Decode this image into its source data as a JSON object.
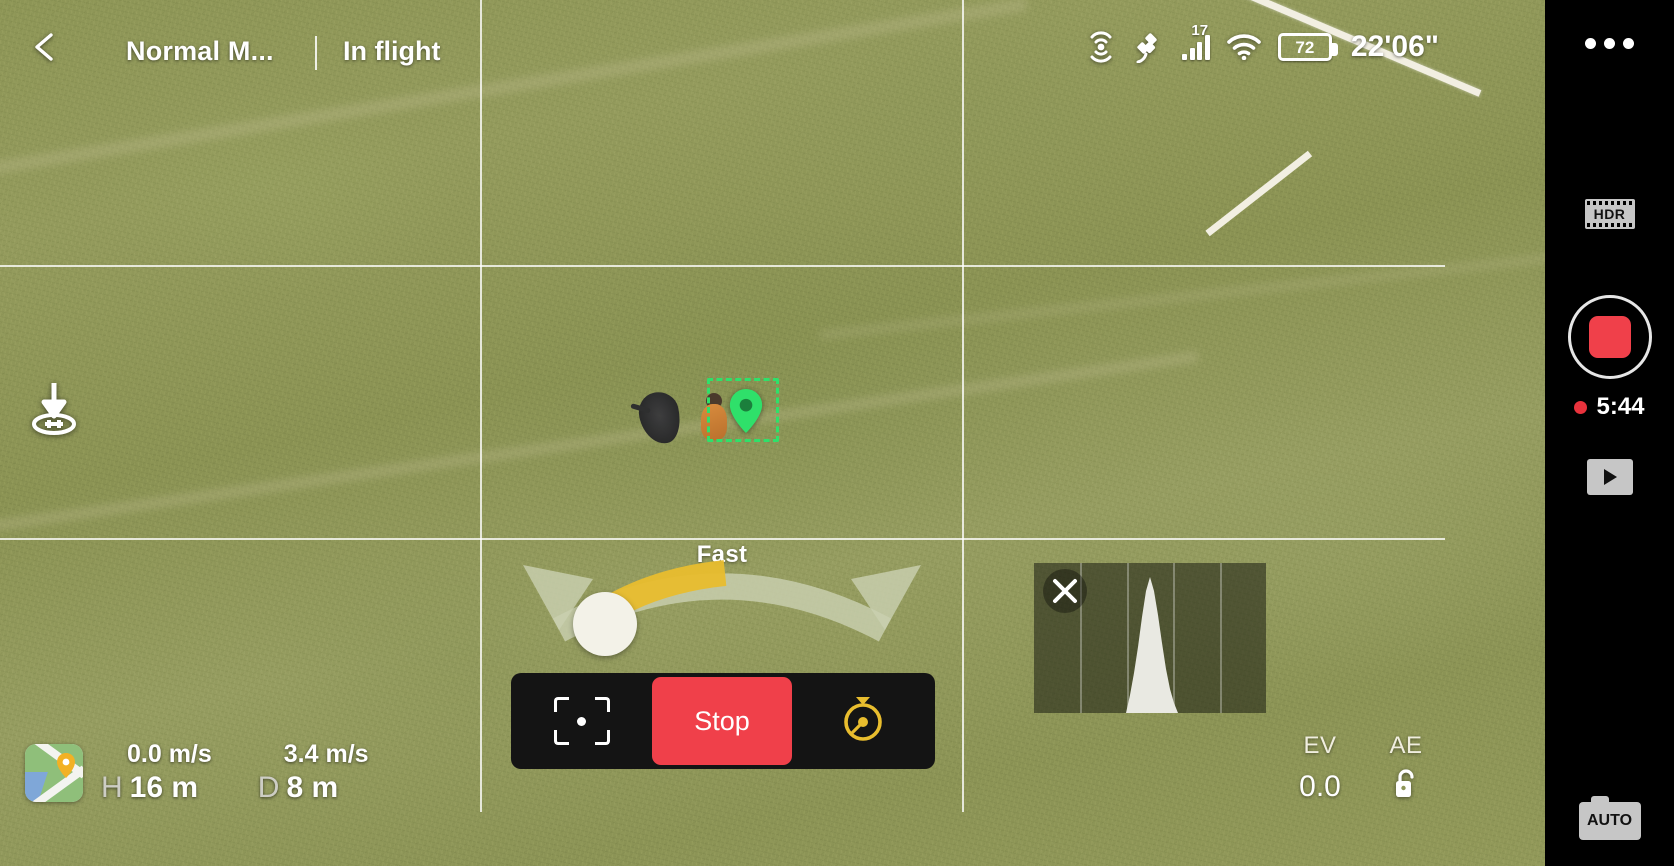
{
  "topbar": {
    "back_icon": "back-chevron-icon",
    "flight_mode": "Normal M...",
    "flight_status": "In flight",
    "status": {
      "rc_signal_icon": "rc-signal-icon",
      "satellite_icon": "satellite-icon",
      "satellite_count": "17",
      "signal_bars_icon": "signal-bars-icon",
      "wifi_icon": "wifi-icon",
      "battery_percent": "72",
      "flight_timer": "22'06\""
    }
  },
  "overlay": {
    "landing_icon": "landing-icon",
    "tracking_pin_icon": "tracking-pin-icon",
    "grid_enabled": true
  },
  "speed_slider": {
    "label": "Fast",
    "knob_icon": "speed-knob",
    "fill_color": "#e8bd2e",
    "track_color": "#c9cfb0"
  },
  "action_bar": {
    "focus_label": "focus-bracket-icon",
    "stop_label": "Stop",
    "stop_color": "#f0404a",
    "gimbal_label": "gimbal-recenter-icon"
  },
  "histogram": {
    "close_icon": "close-icon",
    "visible": true,
    "divisions": 4
  },
  "exposure": {
    "ev_label": "EV",
    "ev_value": "0.0",
    "ae_label": "AE",
    "ae_lock_icon": "unlock-icon"
  },
  "telemetry": {
    "map_icon": "map-thumbnail-icon",
    "vertical_speed": "0.0 m/s",
    "height_key": "H",
    "height_value": "16 m",
    "horizontal_speed": "3.4 m/s",
    "distance_key": "D",
    "distance_value": "8 m"
  },
  "sidebar": {
    "more_icon": "more-options-icon",
    "hdr_label": "HDR",
    "record_icon": "stop-record-icon",
    "record_time": "5:44",
    "playback_icon": "playback-icon",
    "auto_label": "AUTO"
  }
}
